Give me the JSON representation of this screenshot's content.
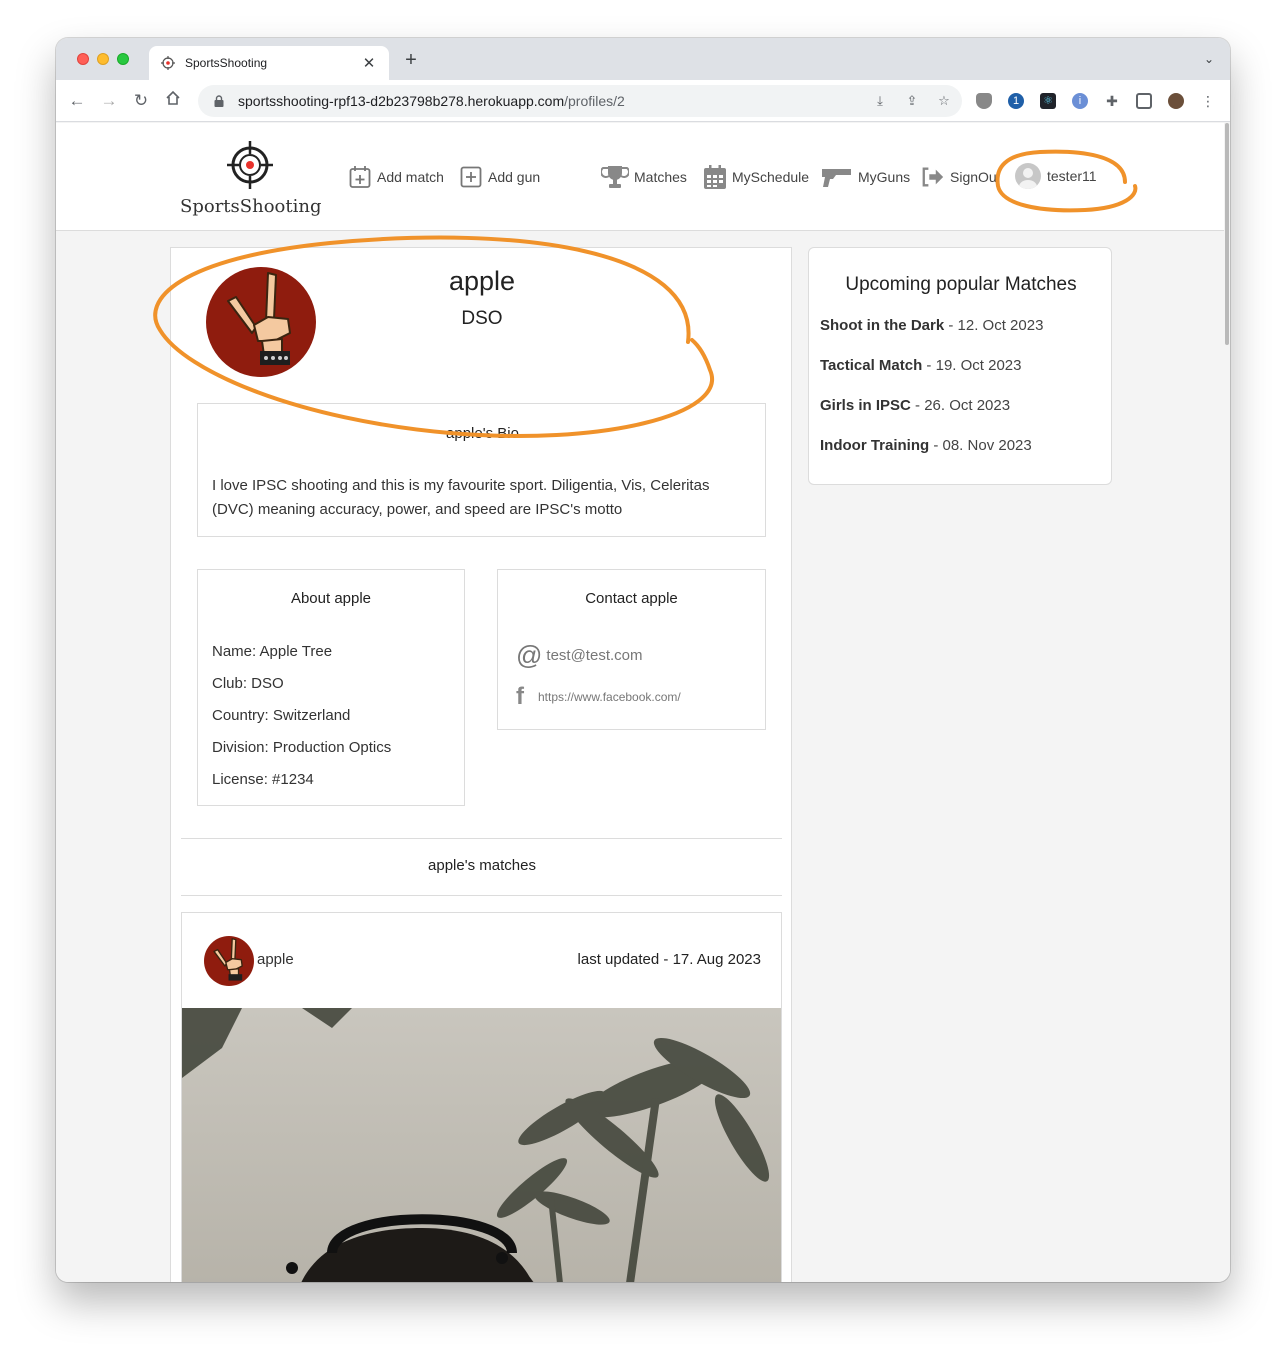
{
  "browser": {
    "tab_title": "SportsShooting",
    "url_host": "sportsshooting-rpf13-d2b23798b278.herokuapp.com",
    "url_path": "/profiles/2"
  },
  "navbar": {
    "brand": "SportsShooting",
    "add_match": "Add match",
    "add_gun": "Add gun",
    "matches": "Matches",
    "myschedule": "MySchedule",
    "myguns": "MyGuns",
    "signout": "SignOut",
    "username": "tester11"
  },
  "profile": {
    "name": "apple",
    "club": "DSO",
    "bio_title": "apple's Bio",
    "bio_text": "I love IPSC shooting and this is my favourite sport. Diligentia, Vis, Celeritas (DVC) meaning accuracy, power, and speed are IPSC's motto",
    "about_title": "About apple",
    "about_name": "Name: Apple Tree",
    "about_club": "Club: DSO",
    "about_country": "Country: Switzerland",
    "about_division": "Division: Production Optics",
    "about_license": "License: #1234",
    "contact_title": "Contact apple",
    "contact_email": "test@test.com",
    "contact_facebook": "https://www.facebook.com/"
  },
  "matches": {
    "section_title": "apple's matches",
    "card_user": "apple",
    "card_updated": "last updated - 17. Aug 2023"
  },
  "sidebar": {
    "title": "Upcoming popular Matches",
    "items": [
      {
        "name": "Shoot in the Dark",
        "date": " - 12. Oct 2023"
      },
      {
        "name": "Tactical Match",
        "date": " - 19. Oct 2023"
      },
      {
        "name": "Girls in IPSC",
        "date": " - 26. Oct 2023"
      },
      {
        "name": "Indoor Training",
        "date": " - 08. Nov 2023"
      }
    ]
  },
  "colors": {
    "annotation": "#f0922a",
    "target_red": "#e8312b",
    "avatar_bg": "#8f1c0e"
  }
}
